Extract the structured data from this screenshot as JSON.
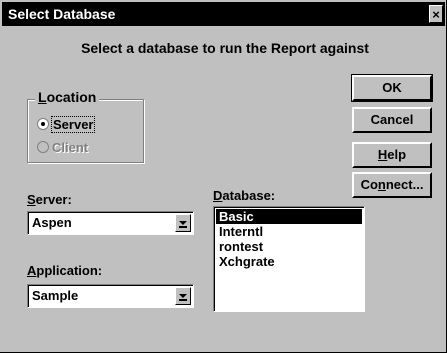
{
  "window": {
    "title": "Select Database",
    "close_glyph": "×"
  },
  "instruction": "Select a database to run the Report against",
  "buttons": {
    "ok": "OK",
    "cancel": "Cancel",
    "help_mnemonic": "H",
    "help_rest": "elp",
    "connect_pre": "Co",
    "connect_mnemonic": "n",
    "connect_rest": "nect..."
  },
  "location": {
    "label_mnemonic": "L",
    "label_rest": "ocation",
    "options": [
      {
        "label": "Server",
        "selected": true,
        "enabled": true
      },
      {
        "label": "Client",
        "selected": false,
        "enabled": false
      }
    ]
  },
  "server": {
    "label_mnemonic": "S",
    "label_rest": "erver:",
    "value": "Aspen"
  },
  "application": {
    "label_mnemonic": "A",
    "label_rest": "pplication:",
    "value": "Sample"
  },
  "database": {
    "label_mnemonic": "D",
    "label_rest": "atabase:",
    "items": [
      "Basic",
      "Interntl",
      "rontest",
      "Xchgrate"
    ],
    "selected_index": 0
  },
  "colors": {
    "dialog_bg": "#c0c0c0",
    "title_bg": "#000000",
    "selection_bg": "#000000"
  }
}
